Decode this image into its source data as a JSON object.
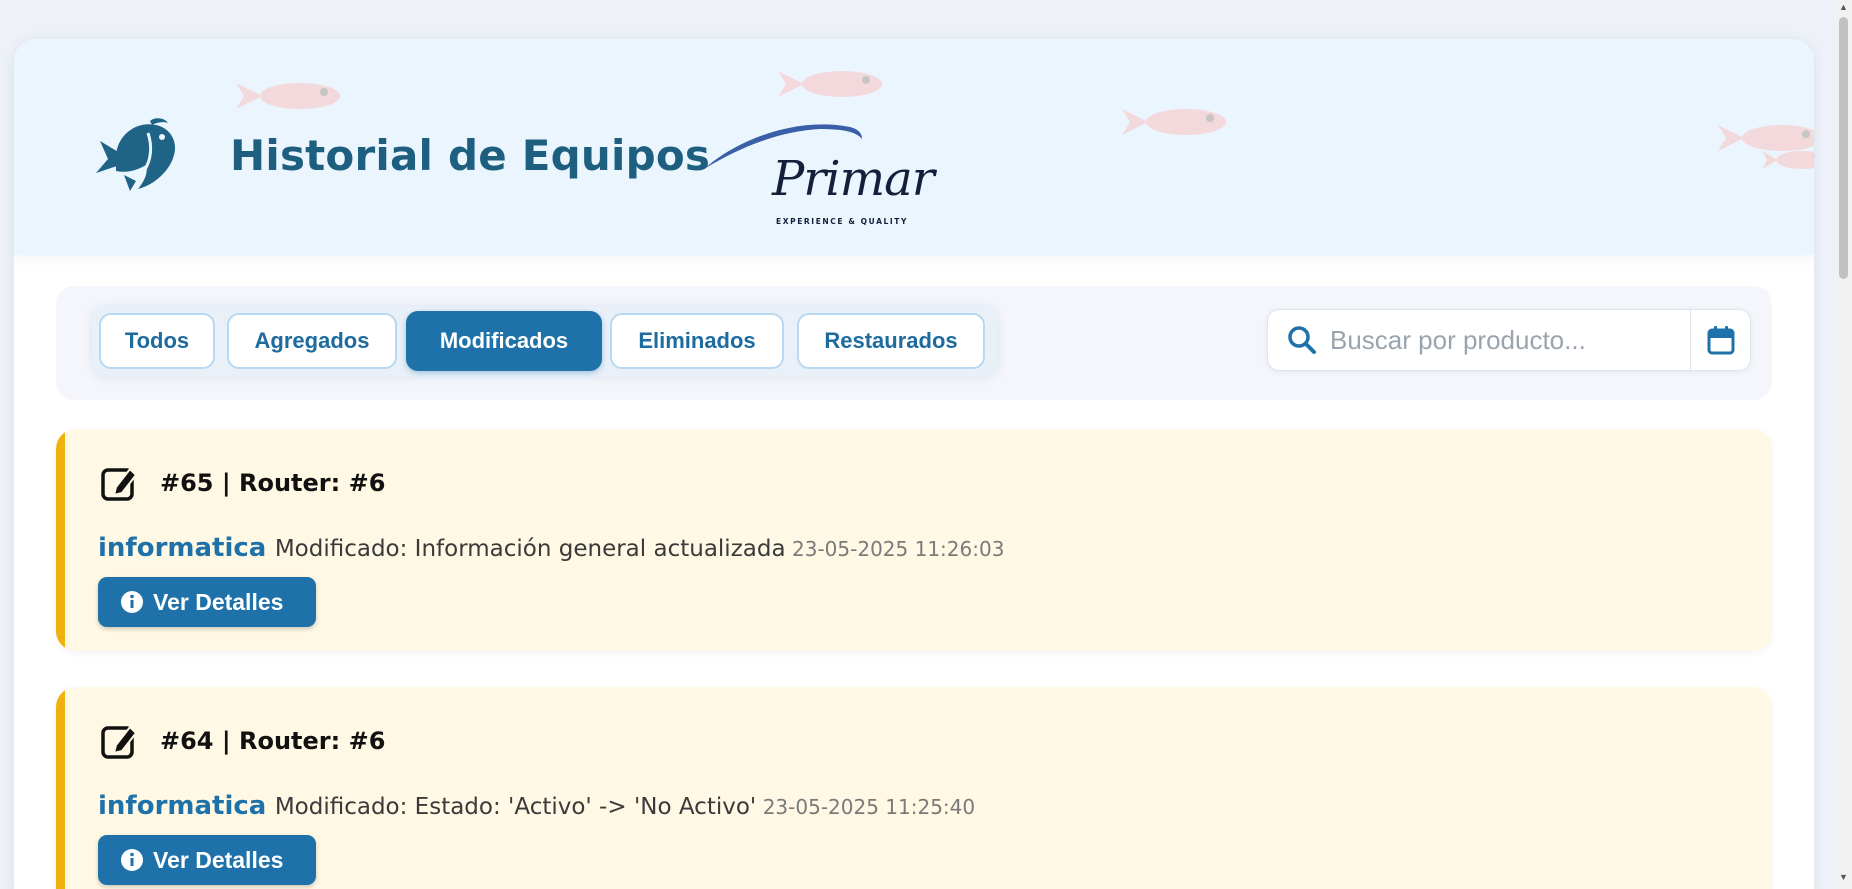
{
  "header": {
    "title": "Historial de Equipos",
    "brand_name": "Primar",
    "brand_tagline": "EXPERIENCE & QUALITY"
  },
  "filters": [
    {
      "label": "Todos",
      "active": false
    },
    {
      "label": "Agregados",
      "active": false
    },
    {
      "label": "Modificados",
      "active": true
    },
    {
      "label": "Eliminados",
      "active": false
    },
    {
      "label": "Restaurados",
      "active": false
    }
  ],
  "search": {
    "placeholder": "Buscar por producto...",
    "value": ""
  },
  "records": [
    {
      "title": "#65 | Router: #6",
      "user": "informatica",
      "action": "Modificado: Información general actualizada",
      "timestamp": "23-05-2025 11:26:03",
      "button_label": "Ver Detalles"
    },
    {
      "title": "#64 | Router: #6",
      "user": "informatica",
      "action": "Modificado: Estado: 'Activo' -> 'No Activo'",
      "timestamp": "23-05-2025 11:25:40",
      "button_label": "Ver Detalles"
    }
  ],
  "icons": {
    "logo": "fish-logo-icon",
    "search": "search-icon",
    "calendar": "calendar-icon",
    "edit": "edit-icon",
    "info": "info-icon"
  },
  "colors": {
    "primary": "#1e72a9",
    "title": "#1e5f80",
    "card_bg": "#fff8e4",
    "card_accent": "#f1b10c",
    "header_bg": "#eaf5fd"
  }
}
